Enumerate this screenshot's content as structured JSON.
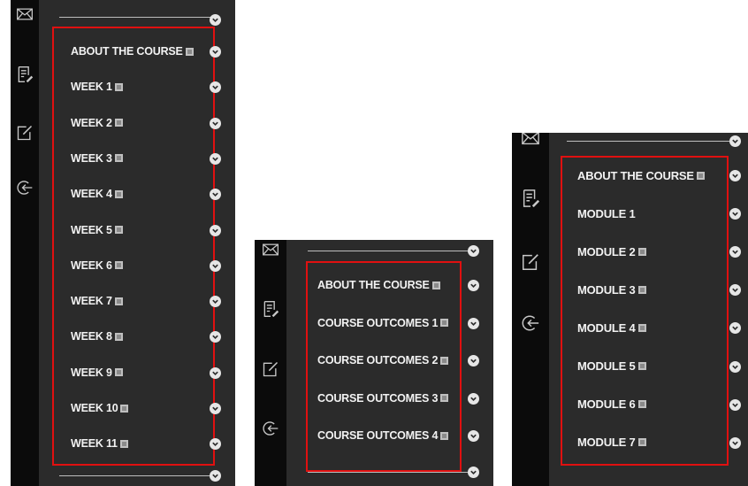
{
  "panels": [
    {
      "name": "weeks",
      "items": [
        {
          "label": "ABOUT THE COURSE",
          "doc": true
        },
        {
          "label": "WEEK 1",
          "doc": true
        },
        {
          "label": "WEEK 2",
          "doc": true
        },
        {
          "label": "WEEK 3",
          "doc": true
        },
        {
          "label": "WEEK 4",
          "doc": true
        },
        {
          "label": "WEEK 5",
          "doc": true
        },
        {
          "label": "WEEK 6",
          "doc": true
        },
        {
          "label": "WEEK 7",
          "doc": true
        },
        {
          "label": "WEEK 8",
          "doc": true
        },
        {
          "label": "WEEK 9",
          "doc": true
        },
        {
          "label": "WEEK 10",
          "doc": true
        },
        {
          "label": "WEEK 11",
          "doc": true
        }
      ]
    },
    {
      "name": "outcomes",
      "items": [
        {
          "label": "ABOUT THE COURSE",
          "doc": true
        },
        {
          "label": "COURSE OUTCOMES 1",
          "doc": true
        },
        {
          "label": "COURSE OUTCOMES 2",
          "doc": true
        },
        {
          "label": "COURSE OUTCOMES 3",
          "doc": true
        },
        {
          "label": "COURSE OUTCOMES 4",
          "doc": true
        }
      ]
    },
    {
      "name": "modules",
      "items": [
        {
          "label": "ABOUT THE COURSE",
          "doc": true
        },
        {
          "label": "MODULE 1",
          "doc": false
        },
        {
          "label": "MODULE 2",
          "doc": true
        },
        {
          "label": "MODULE 3",
          "doc": true
        },
        {
          "label": "MODULE 4",
          "doc": true
        },
        {
          "label": "MODULE 5",
          "doc": true
        },
        {
          "label": "MODULE 6",
          "doc": true
        },
        {
          "label": "MODULE 7",
          "doc": true
        }
      ]
    }
  ],
  "rail_icons": [
    "mail-icon",
    "notes-icon",
    "edit-icon",
    "logout-icon"
  ],
  "colors": {
    "panel_bg": "#2b2b2b",
    "rail_bg": "#0b0b0b",
    "highlight": "#e01010",
    "text": "#f2f2f2"
  }
}
